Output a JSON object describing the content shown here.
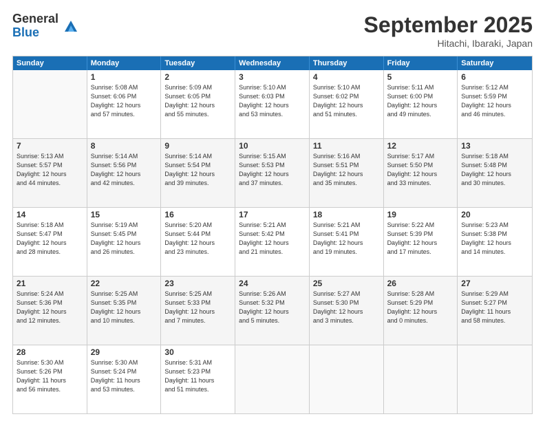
{
  "header": {
    "logo_general": "General",
    "logo_blue": "Blue",
    "title": "September 2025",
    "location": "Hitachi, Ibaraki, Japan"
  },
  "days": [
    "Sunday",
    "Monday",
    "Tuesday",
    "Wednesday",
    "Thursday",
    "Friday",
    "Saturday"
  ],
  "rows": [
    [
      {
        "num": "",
        "info": ""
      },
      {
        "num": "1",
        "info": "Sunrise: 5:08 AM\nSunset: 6:06 PM\nDaylight: 12 hours\nand 57 minutes."
      },
      {
        "num": "2",
        "info": "Sunrise: 5:09 AM\nSunset: 6:05 PM\nDaylight: 12 hours\nand 55 minutes."
      },
      {
        "num": "3",
        "info": "Sunrise: 5:10 AM\nSunset: 6:03 PM\nDaylight: 12 hours\nand 53 minutes."
      },
      {
        "num": "4",
        "info": "Sunrise: 5:10 AM\nSunset: 6:02 PM\nDaylight: 12 hours\nand 51 minutes."
      },
      {
        "num": "5",
        "info": "Sunrise: 5:11 AM\nSunset: 6:00 PM\nDaylight: 12 hours\nand 49 minutes."
      },
      {
        "num": "6",
        "info": "Sunrise: 5:12 AM\nSunset: 5:59 PM\nDaylight: 12 hours\nand 46 minutes."
      }
    ],
    [
      {
        "num": "7",
        "info": "Sunrise: 5:13 AM\nSunset: 5:57 PM\nDaylight: 12 hours\nand 44 minutes."
      },
      {
        "num": "8",
        "info": "Sunrise: 5:14 AM\nSunset: 5:56 PM\nDaylight: 12 hours\nand 42 minutes."
      },
      {
        "num": "9",
        "info": "Sunrise: 5:14 AM\nSunset: 5:54 PM\nDaylight: 12 hours\nand 39 minutes."
      },
      {
        "num": "10",
        "info": "Sunrise: 5:15 AM\nSunset: 5:53 PM\nDaylight: 12 hours\nand 37 minutes."
      },
      {
        "num": "11",
        "info": "Sunrise: 5:16 AM\nSunset: 5:51 PM\nDaylight: 12 hours\nand 35 minutes."
      },
      {
        "num": "12",
        "info": "Sunrise: 5:17 AM\nSunset: 5:50 PM\nDaylight: 12 hours\nand 33 minutes."
      },
      {
        "num": "13",
        "info": "Sunrise: 5:18 AM\nSunset: 5:48 PM\nDaylight: 12 hours\nand 30 minutes."
      }
    ],
    [
      {
        "num": "14",
        "info": "Sunrise: 5:18 AM\nSunset: 5:47 PM\nDaylight: 12 hours\nand 28 minutes."
      },
      {
        "num": "15",
        "info": "Sunrise: 5:19 AM\nSunset: 5:45 PM\nDaylight: 12 hours\nand 26 minutes."
      },
      {
        "num": "16",
        "info": "Sunrise: 5:20 AM\nSunset: 5:44 PM\nDaylight: 12 hours\nand 23 minutes."
      },
      {
        "num": "17",
        "info": "Sunrise: 5:21 AM\nSunset: 5:42 PM\nDaylight: 12 hours\nand 21 minutes."
      },
      {
        "num": "18",
        "info": "Sunrise: 5:21 AM\nSunset: 5:41 PM\nDaylight: 12 hours\nand 19 minutes."
      },
      {
        "num": "19",
        "info": "Sunrise: 5:22 AM\nSunset: 5:39 PM\nDaylight: 12 hours\nand 17 minutes."
      },
      {
        "num": "20",
        "info": "Sunrise: 5:23 AM\nSunset: 5:38 PM\nDaylight: 12 hours\nand 14 minutes."
      }
    ],
    [
      {
        "num": "21",
        "info": "Sunrise: 5:24 AM\nSunset: 5:36 PM\nDaylight: 12 hours\nand 12 minutes."
      },
      {
        "num": "22",
        "info": "Sunrise: 5:25 AM\nSunset: 5:35 PM\nDaylight: 12 hours\nand 10 minutes."
      },
      {
        "num": "23",
        "info": "Sunrise: 5:25 AM\nSunset: 5:33 PM\nDaylight: 12 hours\nand 7 minutes."
      },
      {
        "num": "24",
        "info": "Sunrise: 5:26 AM\nSunset: 5:32 PM\nDaylight: 12 hours\nand 5 minutes."
      },
      {
        "num": "25",
        "info": "Sunrise: 5:27 AM\nSunset: 5:30 PM\nDaylight: 12 hours\nand 3 minutes."
      },
      {
        "num": "26",
        "info": "Sunrise: 5:28 AM\nSunset: 5:29 PM\nDaylight: 12 hours\nand 0 minutes."
      },
      {
        "num": "27",
        "info": "Sunrise: 5:29 AM\nSunset: 5:27 PM\nDaylight: 11 hours\nand 58 minutes."
      }
    ],
    [
      {
        "num": "28",
        "info": "Sunrise: 5:30 AM\nSunset: 5:26 PM\nDaylight: 11 hours\nand 56 minutes."
      },
      {
        "num": "29",
        "info": "Sunrise: 5:30 AM\nSunset: 5:24 PM\nDaylight: 11 hours\nand 53 minutes."
      },
      {
        "num": "30",
        "info": "Sunrise: 5:31 AM\nSunset: 5:23 PM\nDaylight: 11 hours\nand 51 minutes."
      },
      {
        "num": "",
        "info": ""
      },
      {
        "num": "",
        "info": ""
      },
      {
        "num": "",
        "info": ""
      },
      {
        "num": "",
        "info": ""
      }
    ]
  ]
}
